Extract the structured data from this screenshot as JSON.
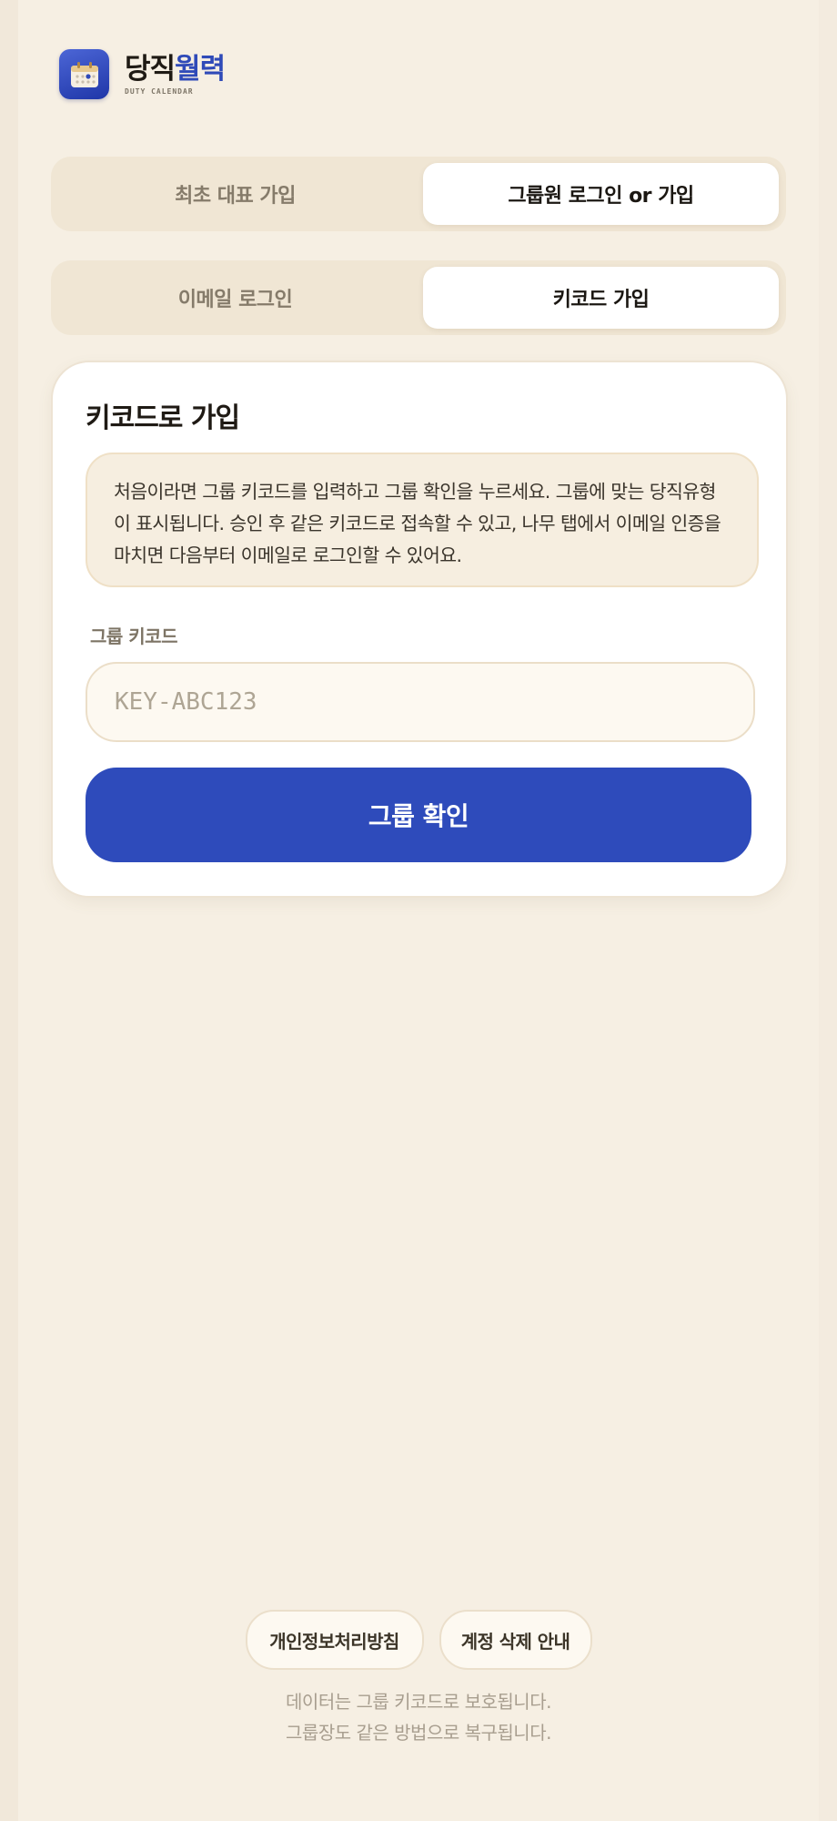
{
  "brand": {
    "title_main": "당직",
    "title_accent": "월력",
    "subtitle": "DUTY CALENDAR",
    "logo_icon": "calendar-icon",
    "accent_color": "#2f4ab8"
  },
  "role_tabs": [
    {
      "label": "최초 대표 가입",
      "active": false
    },
    {
      "label": "그룹원 로그인 or 가입",
      "active": true
    }
  ],
  "method_tabs": [
    {
      "label": "이메일 로그인",
      "active": false
    },
    {
      "label": "키코드 가입",
      "active": true
    }
  ],
  "card": {
    "title": "키코드로 가입",
    "info_text": "처음이라면 그룹 키코드를 입력하고 그룹 확인을 누르세요. 그룹에 맞는 당직유형이 표시됩니다. 승인 후 같은 키코드로 접속할 수 있고, 나무 탭에서 이메일 인증을 마치면 다음부터 이메일로 로그인할 수 있어요.",
    "field_label": "그룹 키코드",
    "input_value": "",
    "input_placeholder": "KEY-ABC123",
    "confirm_label": "그룹 확인",
    "button_color": "#2e4bbb"
  },
  "footer": {
    "privacy_label": "개인정보처리방침",
    "delete_label": "계정 삭제 안내",
    "note_line1": "데이터는 그룹 키코드로 보호됩니다.",
    "note_line2": "그룹장도 같은 방법으로 복구됩니다."
  }
}
